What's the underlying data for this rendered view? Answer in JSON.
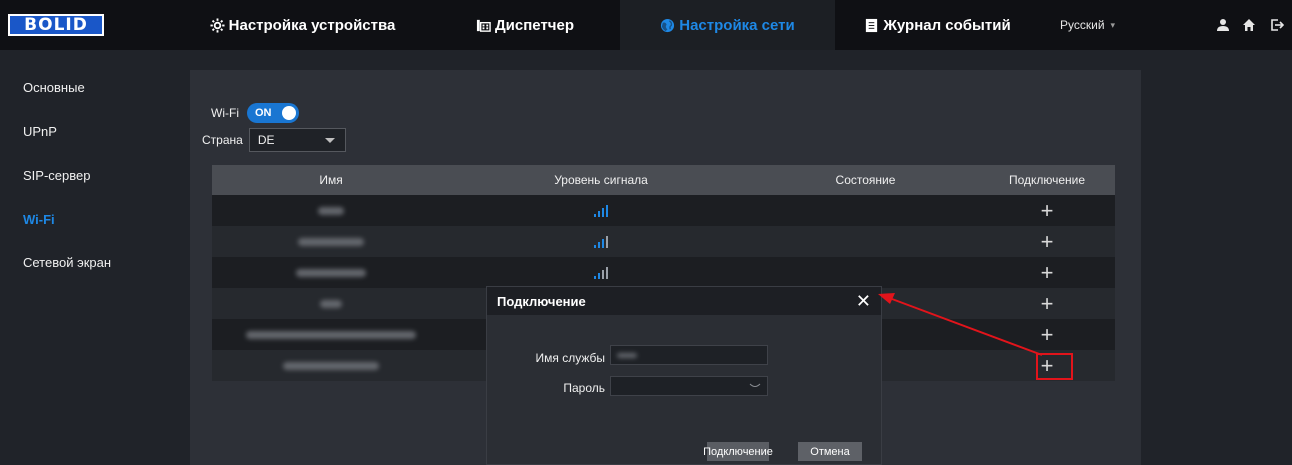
{
  "header": {
    "logo": "BOLID",
    "tabs": [
      {
        "label": "Настройка устройства",
        "icon": "gear-icon",
        "active": false
      },
      {
        "label": "Диспетчер",
        "icon": "grid-icon",
        "active": false
      },
      {
        "label": "Настройка сети",
        "icon": "globe-icon",
        "active": true
      },
      {
        "label": "Журнал событий",
        "icon": "journal-icon",
        "active": false
      }
    ],
    "language": "Русский",
    "icons": [
      "user-icon",
      "home-icon",
      "logout-icon"
    ]
  },
  "sidebar": {
    "items": [
      {
        "label": "Основные",
        "active": false
      },
      {
        "label": "UPnP",
        "active": false
      },
      {
        "label": "SIP-сервер",
        "active": false
      },
      {
        "label": "Wi-Fi",
        "active": true
      },
      {
        "label": "Сетевой экран",
        "active": false
      }
    ]
  },
  "wifi": {
    "label": "Wi-Fi",
    "toggle": "ON",
    "country_label": "Страна",
    "country_value": "DE"
  },
  "table": {
    "columns": [
      "Имя",
      "Уровень сигнала",
      "Состояние",
      "Подключение"
    ],
    "rows": [
      {
        "signal": true,
        "action": "+"
      },
      {
        "signal": true,
        "action": "+"
      },
      {
        "signal": true,
        "action": "+"
      },
      {
        "signal": false,
        "action": "+"
      },
      {
        "signal": false,
        "action": "+"
      },
      {
        "signal": false,
        "action": "+"
      }
    ]
  },
  "modal": {
    "title": "Подключение",
    "close": "✕",
    "service_label": "Имя службы",
    "password_label": "Пароль",
    "connect_button": "Подключение",
    "cancel_button": "Отмена"
  },
  "colors": {
    "accent": "#1e88e5",
    "annotation": "#e2141b"
  }
}
